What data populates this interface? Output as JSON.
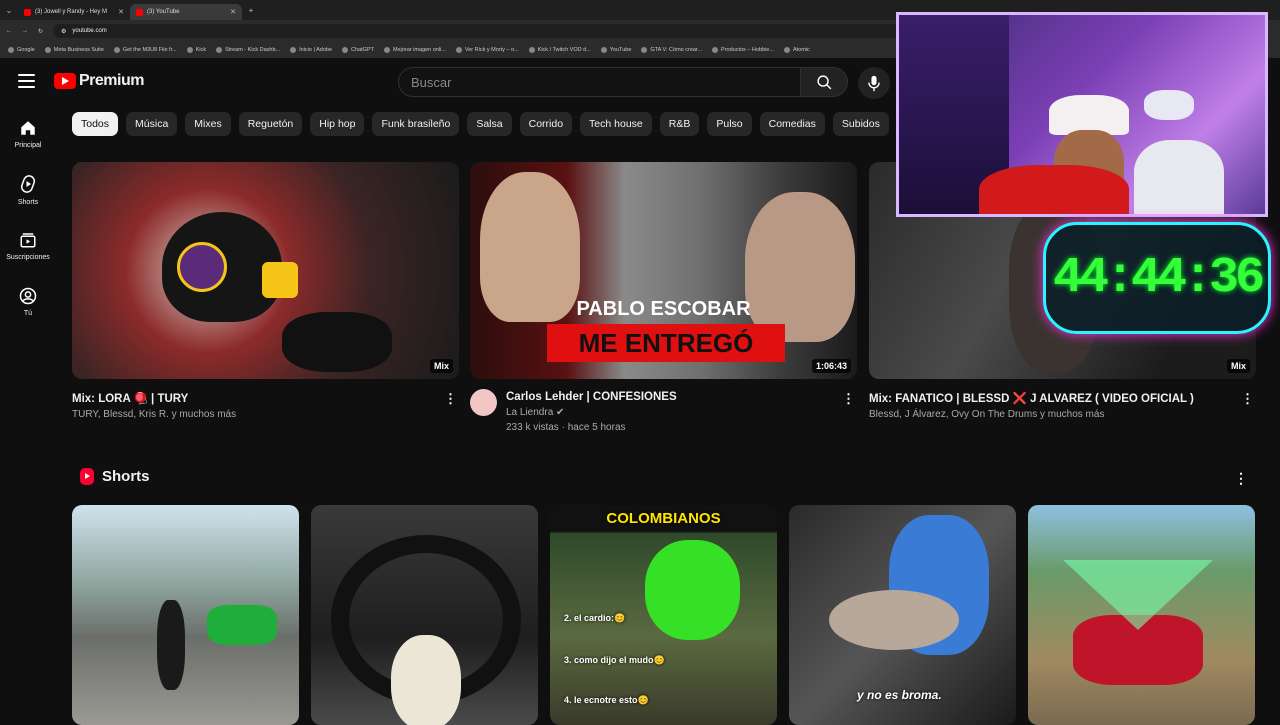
{
  "browser": {
    "tabs": [
      {
        "label": "(3) Jowell y Randy - Hey M",
        "active": false
      },
      {
        "label": "(3) YouTube",
        "active": true
      }
    ],
    "url": "youtube.com",
    "bookmarks": [
      "Google",
      "Meta Business Suite",
      "Get the M3U8 File fr...",
      "Kick",
      "Stream - Kick Dashb...",
      "Inicio | Adobe",
      "ChatGPT",
      "Mejorar imagen onli...",
      "Ver Rick y Morty – o...",
      "Kick / Twitch VOD d...",
      "YouTube",
      "GTA V: Cómo crear...",
      "Productos – Hobbie...",
      "Atomic"
    ]
  },
  "header": {
    "logo_text": "Premium",
    "search_placeholder": "Buscar"
  },
  "sidebar": {
    "items": [
      {
        "label": "Principal",
        "icon": "home-icon"
      },
      {
        "label": "Shorts",
        "icon": "shorts-icon"
      },
      {
        "label": "Suscripciones",
        "icon": "subscriptions-icon"
      },
      {
        "label": "Tú",
        "icon": "user-icon"
      }
    ]
  },
  "chips": [
    "Todos",
    "Música",
    "Mixes",
    "Reguetón",
    "Hip hop",
    "Funk brasileño",
    "Salsa",
    "Corrido",
    "Tech house",
    "R&B",
    "Pulso",
    "Comedias",
    "Subidos"
  ],
  "videos": [
    {
      "title": "Mix: LORA 🪀 | TURY",
      "meta": "TURY, Blessd, Kris R. y muchos más",
      "badge": "Mix"
    },
    {
      "title": "Carlos Lehder | CONFESIONES",
      "channel": "La Liendra ✔",
      "meta": "233 k vistas · hace 5 horas",
      "badge": "1:06:43",
      "thumb_line1": "PABLO ESCOBAR",
      "thumb_line2": "ME ENTREGÓ"
    },
    {
      "title": "Mix: FANATICO | BLESSD ❌ J ALVAREZ ( VIDEO OFICIAL )",
      "meta": "Blessd, J Álvarez, Ovy On The Drums y muchos más",
      "badge": "Mix"
    }
  ],
  "shorts": {
    "heading": "Shorts",
    "items": [
      {
        "caption": ""
      },
      {
        "caption": ""
      },
      {
        "caption": "COLOMBIANOS",
        "lines": [
          "2. el cardio:😊",
          "3. como dijo el mudo😊",
          "4. le ecnotre esto😊"
        ]
      },
      {
        "caption": "y no es broma."
      },
      {
        "caption": ""
      }
    ]
  },
  "overlay": {
    "timer": "44:44:36"
  },
  "colors": {
    "brand": "#ff0000",
    "background": "#0f0f0f",
    "timer_text": "#36ff3a"
  }
}
